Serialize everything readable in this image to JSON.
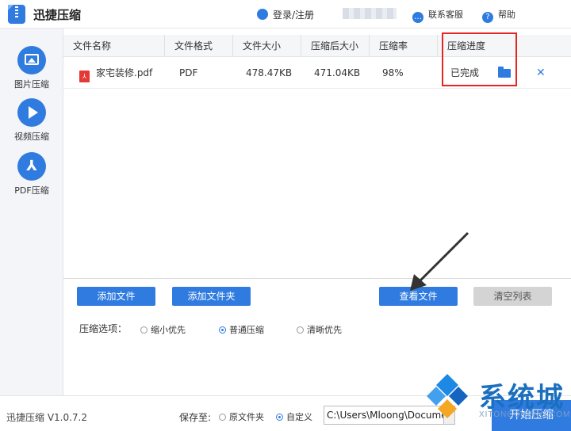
{
  "titlebar": {
    "app_title": "迅捷压缩",
    "login": "登录/注册",
    "service": "联系客服",
    "help": "帮助"
  },
  "sidebar": {
    "items": [
      {
        "label": "图片压缩"
      },
      {
        "label": "视频压缩"
      },
      {
        "label": "PDF压缩"
      }
    ]
  },
  "table": {
    "headers": [
      "文件名称",
      "文件格式",
      "文件大小",
      "压缩后大小",
      "压缩率",
      "压缩进度"
    ],
    "rows": [
      {
        "name": "家宅装修.pdf",
        "format": "PDF",
        "size": "478.47KB",
        "compressed_size": "471.04KB",
        "rate": "98%",
        "progress": "已完成",
        "icon": "pdf-icon"
      }
    ]
  },
  "buttons": {
    "add_file": "添加文件",
    "add_folder": "添加文件夹",
    "view_file": "查看文件",
    "clear_list": "清空列表"
  },
  "compress_options": {
    "label": "压缩选项：",
    "choices": [
      "缩小优先",
      "普通压缩",
      "清晰优先"
    ],
    "selected": "普通压缩"
  },
  "footer": {
    "version": "迅捷压缩 V1.0.7.2",
    "save_to_label": "保存至:",
    "save_choices": [
      "原文件夹",
      "自定义"
    ],
    "save_selected": "自定义",
    "save_path": "C:\\Users\\Mloong\\Documents",
    "start_button": "开始压缩"
  },
  "watermark": {
    "text": "系统城",
    "sub": "XITONGCHENG.COM"
  },
  "colors": {
    "accent": "#2f7be0",
    "highlight": "#e52521"
  }
}
